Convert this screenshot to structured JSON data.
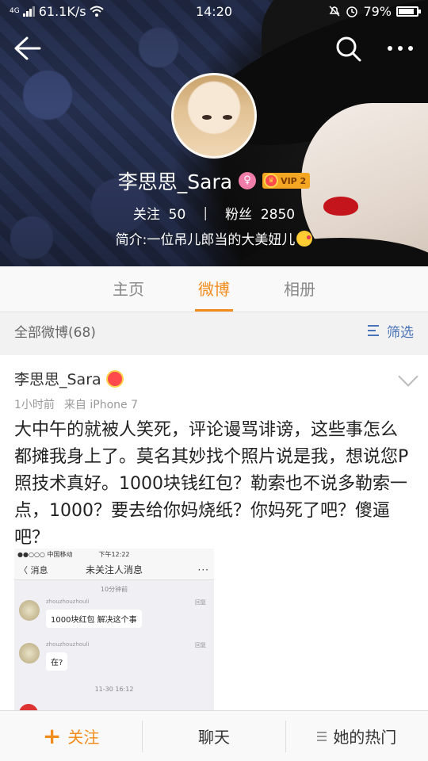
{
  "status_bar": {
    "network": "4G",
    "speed": "61.1K/s",
    "time": "14:20",
    "battery": "79%"
  },
  "header": {
    "back_icon": "arrow-left-icon",
    "search_icon": "search-icon",
    "more_icon": "more-dots-icon"
  },
  "profile": {
    "name": "李思思_Sara",
    "vip_label": "VIP 2",
    "following_label": "关注",
    "following_count": "50",
    "divider": "|",
    "followers_label": "粉丝",
    "followers_count": "2850",
    "bio": "简介:一位吊儿郎当的大美妞儿"
  },
  "tabs": [
    {
      "label": "主页"
    },
    {
      "label": "微博"
    },
    {
      "label": "相册"
    }
  ],
  "filter": {
    "all_posts": "全部微博(68)",
    "filter_label": "筛选"
  },
  "post": {
    "author": "李思思_Sara",
    "time": "1小时前",
    "source": "来自 iPhone 7",
    "text": "大中午的就被人笑死，评论谩骂诽谤，这些事怎么都摊我身上了。莫名其妙找个照片说是我，想说您P照技术真好。1000块钱红包？勒索也不说多勒索一点，1000？要去给你妈烧纸？你妈死了吧？傻逼吧？",
    "image": {
      "carrier": "●●○○○ 中国移动",
      "time": "下午12:22",
      "back_label": "〈 消息",
      "title": "未关注人消息",
      "more": "···",
      "stamp1": "10分钟前",
      "stamp2": "11-30 16:12",
      "messages": [
        {
          "user": "zhouzhouzhouli",
          "report": "回复",
          "text": "1000块红包 解决这个事"
        },
        {
          "user": "zhouzhouzhouli",
          "report": "回复",
          "text": "在?"
        }
      ]
    }
  },
  "bottom_bar": {
    "follow": "关注",
    "chat": "聊天",
    "hot": "她的热门"
  },
  "colors": {
    "accent": "#f28c1c",
    "link": "#4a74b8"
  }
}
